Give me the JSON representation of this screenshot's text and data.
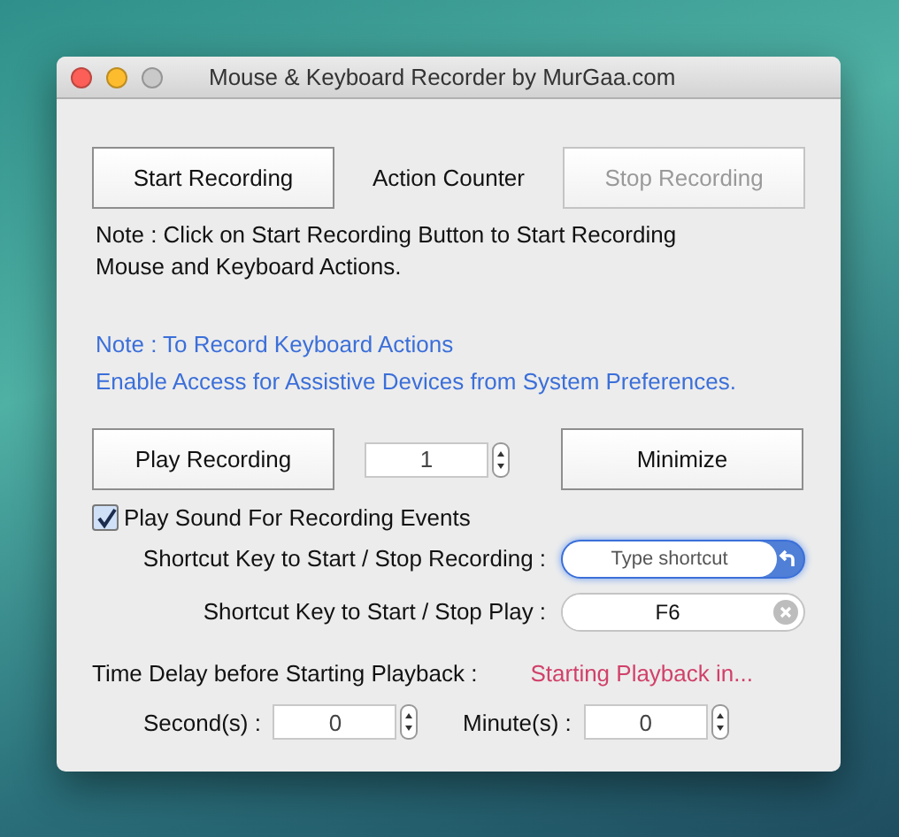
{
  "window": {
    "title": "Mouse & Keyboard Recorder by MurGaa.com"
  },
  "top_row": {
    "start_button": {
      "label": "Start Recording",
      "disabled": false
    },
    "counter_label": "Action Counter",
    "stop_button": {
      "label": "Stop Recording",
      "disabled": true
    }
  },
  "note": "Note : Click on Start Recording Button to Start Recording Mouse and Keyboard Actions.",
  "keyboard_note": [
    "Note : To Record Keyboard Actions",
    "Enable Access for Assistive Devices from System Preferences."
  ],
  "play_row": {
    "play_button": {
      "label": "Play Recording",
      "disabled": false
    },
    "repeat_count": "1",
    "minimize_button": {
      "label": "Minimize",
      "disabled": false
    }
  },
  "sound_checkbox": {
    "label": "Play Sound For Recording Events",
    "checked": true
  },
  "shortcuts": [
    {
      "label": "Shortcut Key to Start / Stop Recording :",
      "placeholder": "Type shortcut",
      "focused": true
    },
    {
      "label": "Shortcut Key to Start / Stop Play  :",
      "value": "F6",
      "focused": false
    }
  ],
  "time_delay": {
    "label": "Time Delay before Starting Playback :",
    "status": "Starting Playback in..."
  },
  "delays": [
    {
      "label": "Second(s) :",
      "value": "0"
    },
    {
      "label": "Minute(s) :",
      "value": "0"
    }
  ]
}
